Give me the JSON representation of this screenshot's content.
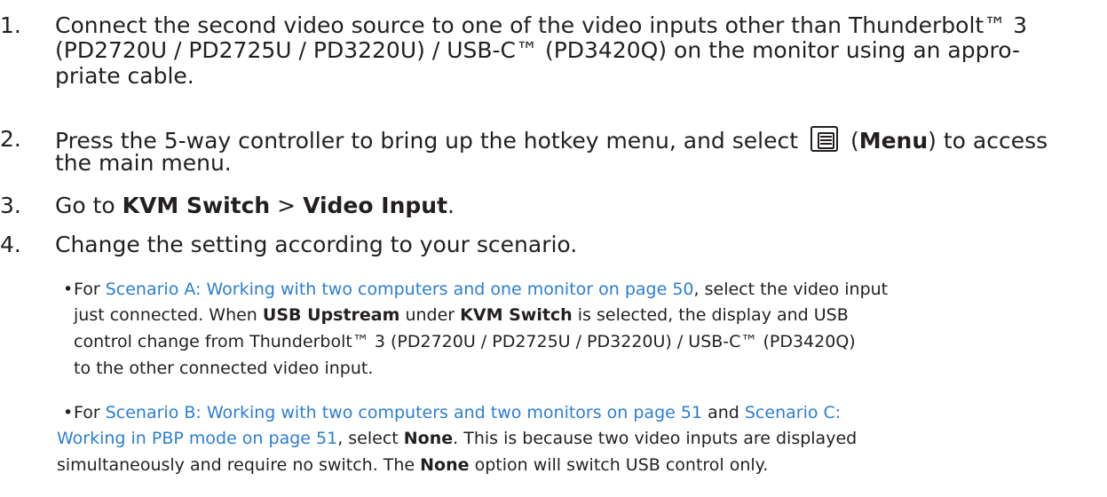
{
  "steps": [
    {
      "number": "1.",
      "lines": [
        "Connect the second video source to one of the video inputs other than Thunderbolt™ 3",
        "(PD2720U / PD2725U / PD3220U) / USB-C™ (PD3420Q) on the monitor using an appro-",
        "priate cable."
      ]
    },
    {
      "number": "2.",
      "before_icon": "Press the 5-way controller to bring up the hotkey menu, and select",
      "paren_open": "(",
      "menu_bold": "Menu",
      "paren_close": ") to access",
      "line2": "the main menu.",
      "icon": "menu-icon"
    },
    {
      "number": "3.",
      "go_to": "Go to ",
      "kvm": "KVM Switch",
      "sep": " > ",
      "video_input": "Video Input",
      "period": "."
    },
    {
      "number": "4.",
      "text": "Change the setting according to your scenario."
    }
  ],
  "bullets": {
    "marker": "•",
    "a": {
      "for": "For ",
      "link": "Scenario A: Working with two computers and one monitor on page 50",
      "after_link": ", select the video input",
      "line2_pre": "just connected. When ",
      "usb_upstream": "USB Upstream",
      "under": " under ",
      "kvm": "KVM Switch",
      "line2_post": " is selected, the display and USB",
      "line3": "control change from Thunderbolt™ 3 (PD2720U / PD2725U / PD3220U) / USB-C™ (PD3420Q)",
      "line4": "to the other connected video input."
    },
    "b": {
      "for": "For ",
      "link_b": "Scenario B: Working with two computers and two monitors on page 51",
      "and": " and ",
      "link_c1": "Scenario C:",
      "link_c2": "Working in PBP mode on page 51",
      "sel": ", select ",
      "none": "None",
      "line2_post": ". This is because two video inputs are displayed",
      "line3_pre": "simultaneously and require no switch. The ",
      "none2": "None",
      "line3_post": " option will switch USB control only."
    }
  }
}
